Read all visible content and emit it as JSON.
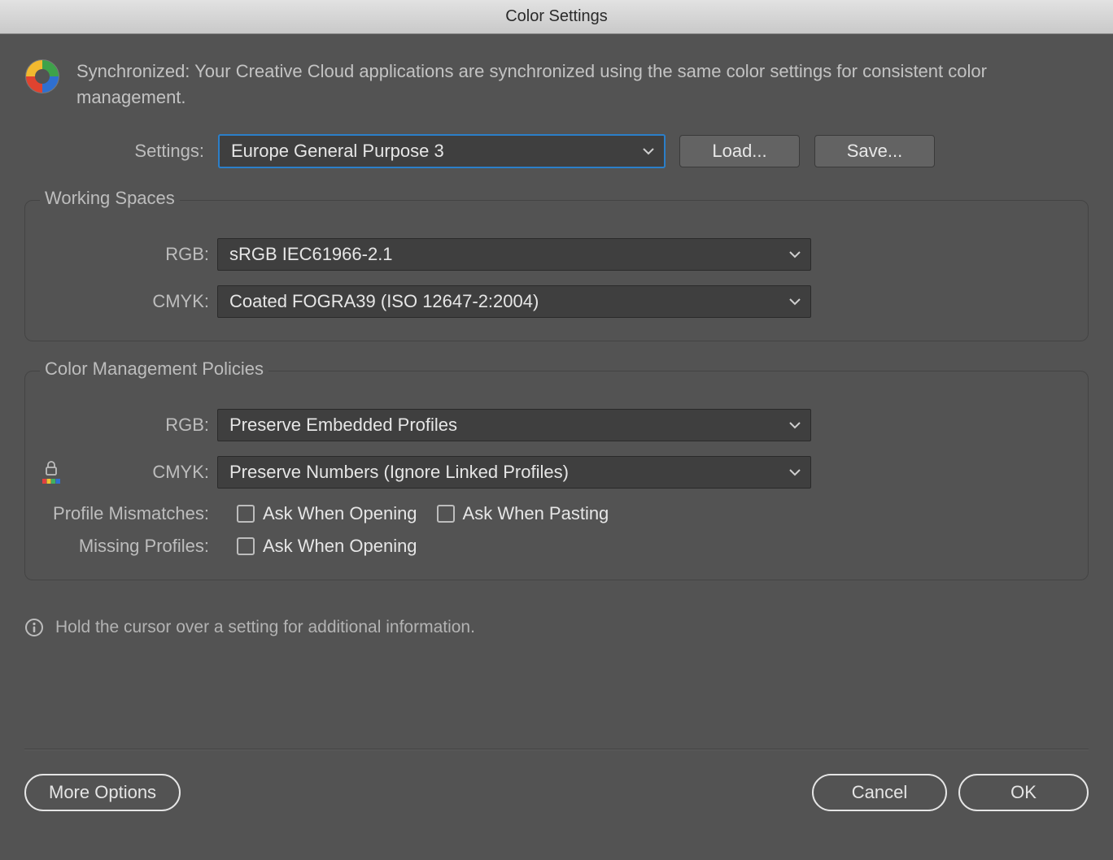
{
  "window": {
    "title": "Color Settings"
  },
  "sync": {
    "text": "Synchronized: Your Creative Cloud applications are synchronized using the same color settings for consistent color management."
  },
  "settings": {
    "label": "Settings:",
    "value": "Europe General Purpose 3",
    "load": "Load...",
    "save": "Save..."
  },
  "workingSpaces": {
    "legend": "Working Spaces",
    "rgbLabel": "RGB:",
    "rgbValue": "sRGB IEC61966-2.1",
    "cmykLabel": "CMYK:",
    "cmykValue": "Coated FOGRA39 (ISO 12647-2:2004)"
  },
  "policies": {
    "legend": "Color Management Policies",
    "rgbLabel": "RGB:",
    "rgbValue": "Preserve Embedded Profiles",
    "cmykLabel": "CMYK:",
    "cmykValue": "Preserve Numbers (Ignore Linked Profiles)",
    "mismatchLabel": "Profile Mismatches:",
    "askOpen": "Ask When Opening",
    "askPaste": "Ask When Pasting",
    "missingLabel": "Missing Profiles:"
  },
  "info": {
    "text": "Hold the cursor over a setting for additional information."
  },
  "footer": {
    "more": "More Options",
    "cancel": "Cancel",
    "ok": "OK"
  }
}
